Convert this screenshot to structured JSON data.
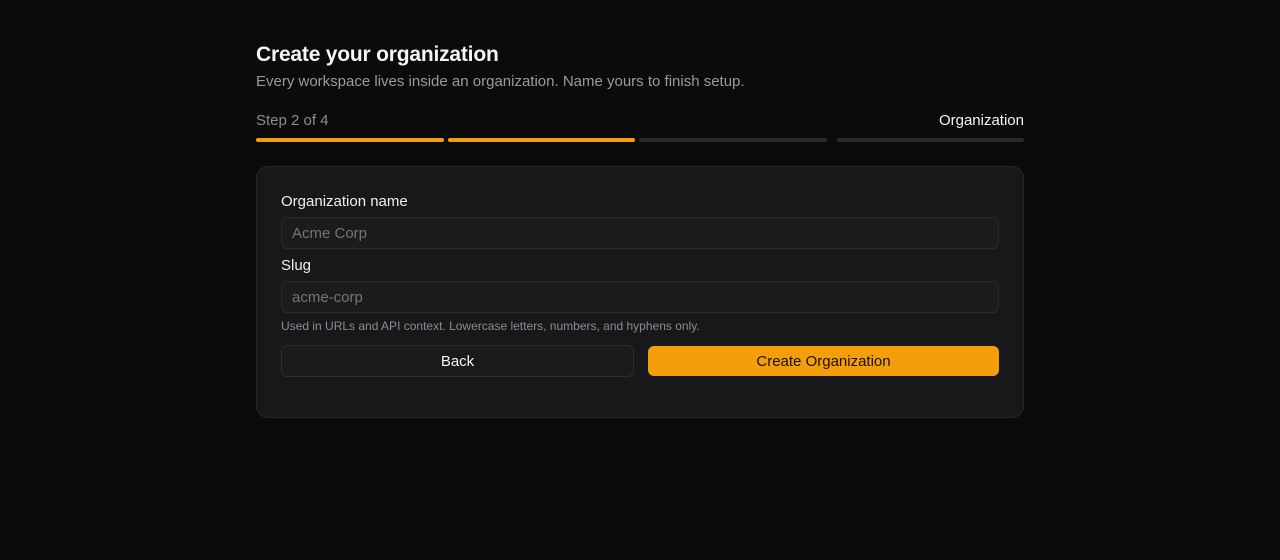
{
  "header": {
    "title": "Create your organization",
    "subtitle": "Every workspace lives inside an organization. Name yours to finish setup."
  },
  "stepper": {
    "step_text": "Step 2 of 4",
    "current_step_name": "Organization",
    "total_steps": 4,
    "completed_steps": 2
  },
  "form": {
    "org_name": {
      "label": "Organization name",
      "placeholder": "Acme Corp",
      "value": ""
    },
    "slug": {
      "label": "Slug",
      "placeholder": "acme-corp",
      "value": "",
      "hint": "Used in URLs and API context. Lowercase letters, numbers, and hyphens only."
    }
  },
  "actions": {
    "back_label": "Back",
    "submit_label": "Create Organization"
  },
  "colors": {
    "accent": "#f59e0b",
    "background": "#0b0b0c",
    "card": "#18181a"
  }
}
